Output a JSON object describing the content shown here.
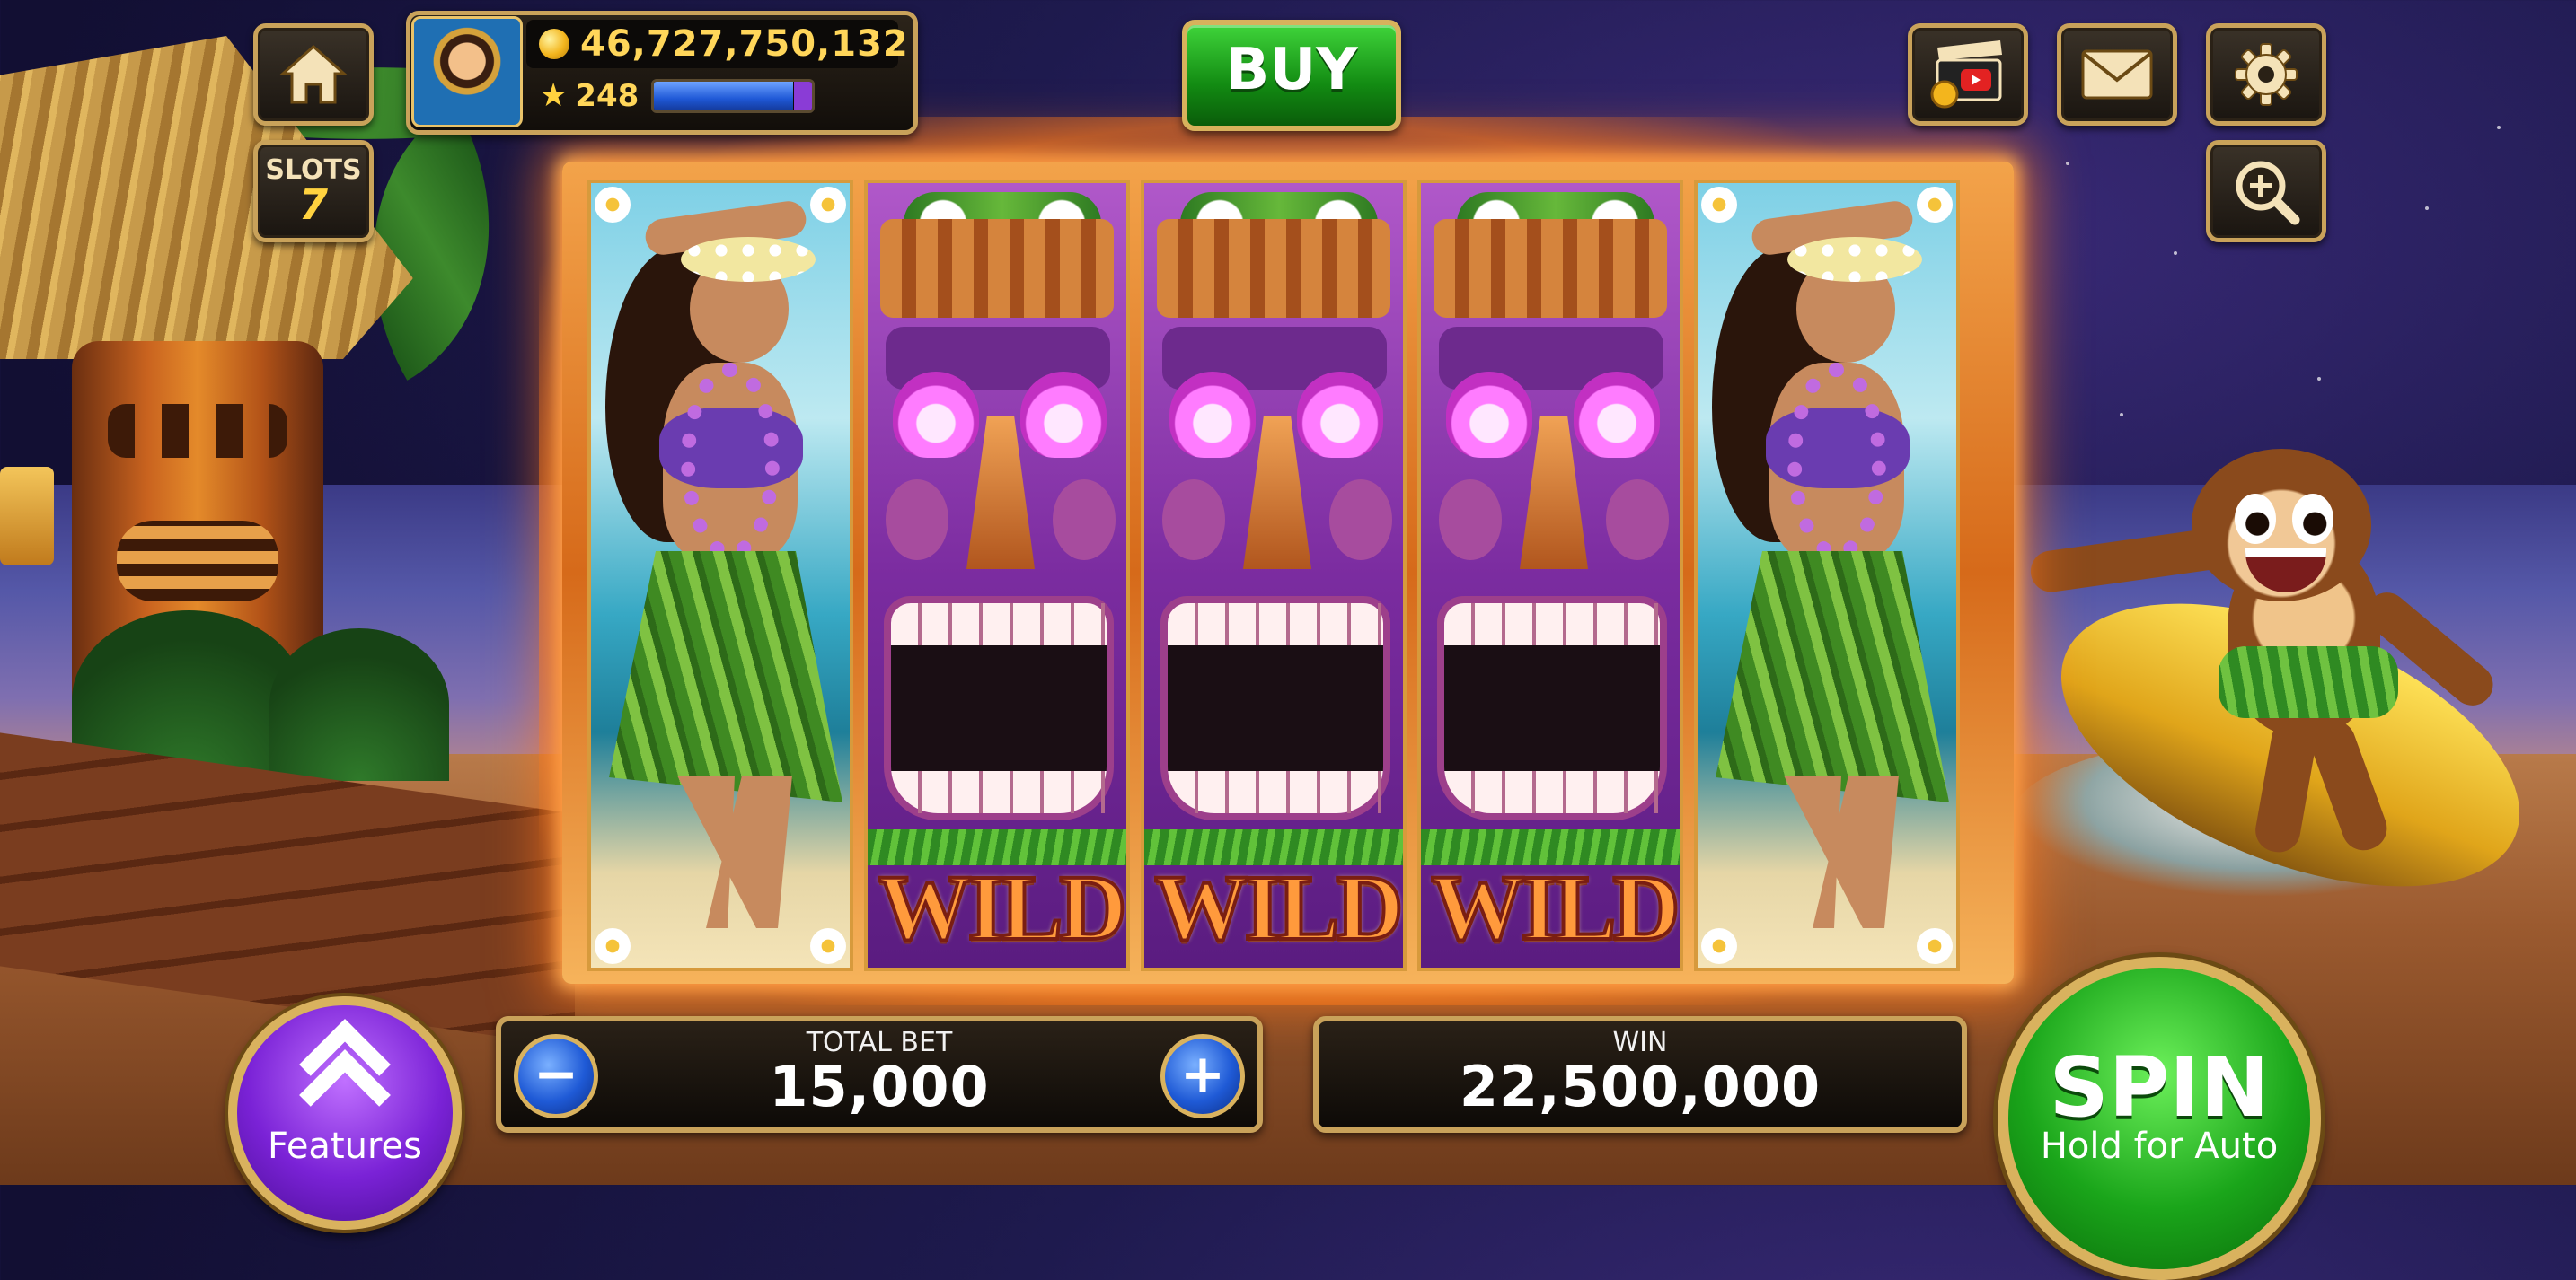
{
  "header": {
    "home_icon": "home-icon",
    "slots_badge": {
      "line1": "SLOTS",
      "line2": "7"
    },
    "balance": "46,727,750,132",
    "level": "248",
    "xp_progress": 0.88,
    "buy_label": "BUY",
    "video_icon": "video-reward-icon",
    "mail_icon": "mail-icon",
    "settings_icon": "gear-icon",
    "zoom_icon": "zoom-in-icon"
  },
  "reels": [
    {
      "symbol": "hula-dancer",
      "label": ""
    },
    {
      "symbol": "tiki-wild",
      "label": "WILD"
    },
    {
      "symbol": "tiki-wild",
      "label": "WILD"
    },
    {
      "symbol": "tiki-wild",
      "label": "WILD"
    },
    {
      "symbol": "hula-dancer",
      "label": ""
    }
  ],
  "controls": {
    "features_label": "Features",
    "total_bet_label": "TOTAL BET",
    "total_bet_value": "15,000",
    "minus_label": "−",
    "plus_label": "+",
    "win_label": "WIN",
    "win_value": "22,500,000",
    "spin_label": "SPIN",
    "spin_sub": "Hold for Auto"
  },
  "colors": {
    "accent_gold": "#c9a25a",
    "spin_green": "#1aa51a",
    "features_purple": "#7a22d6",
    "buy_green": "#128a12"
  }
}
